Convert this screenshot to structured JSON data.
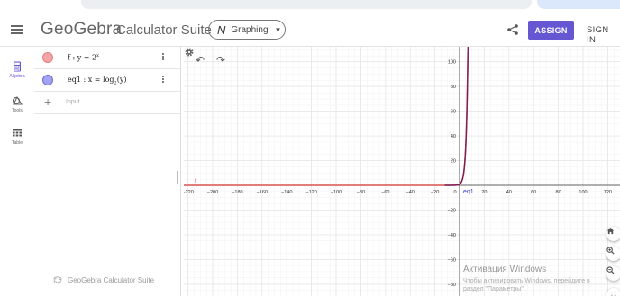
{
  "header": {
    "logo": "GeoGebra",
    "suite": "Calculator Suite",
    "app_switch": "Graphing",
    "assign_label": "ASSIGN",
    "signin_label": "SIGN IN"
  },
  "rail": {
    "items": [
      {
        "label": "Algebra",
        "icon": "calculator-icon",
        "active": true
      },
      {
        "label": "Tools",
        "icon": "tools-icon",
        "active": false
      },
      {
        "label": "Table",
        "icon": "table-icon",
        "active": false
      }
    ]
  },
  "algebra": {
    "rows": [
      {
        "expr_main": "f : y = 2",
        "expr_sup": "x",
        "color": "#f4a6a6",
        "color_border": "#d66"
      },
      {
        "expr_main": "eq1 : x = log",
        "expr_sub": "2",
        "expr_tail": "(y)",
        "color": "#a3a3f2",
        "color_border": "#66c"
      }
    ],
    "input_placeholder": "Input..."
  },
  "footer": {
    "brand": "GeoGebra Calculator Suite"
  },
  "graphics": {
    "x_ticks": [
      "−220",
      "−200",
      "−180",
      "−160",
      "−140",
      "−120",
      "−100",
      "−80",
      "−60",
      "−40",
      "−20",
      "0",
      "20",
      "40",
      "60",
      "80",
      "100",
      "120"
    ],
    "y_ticks_pos": [
      "100",
      "80",
      "60",
      "40",
      "20"
    ],
    "y_ticks_neg": [
      "−20",
      "−40",
      "−60",
      "−80"
    ],
    "label_f": "f",
    "label_eq1": "eq1",
    "f_color": "#d9534f",
    "eq1_color": "#7a1f5c",
    "grid_color": "#e6e6e6",
    "axis_color": "#333333"
  },
  "watermark": {
    "title": "Активация Windows",
    "line1": "Чтобы активировать Windows, перейдите в",
    "line2": "раздел \"Параметры\"."
  }
}
